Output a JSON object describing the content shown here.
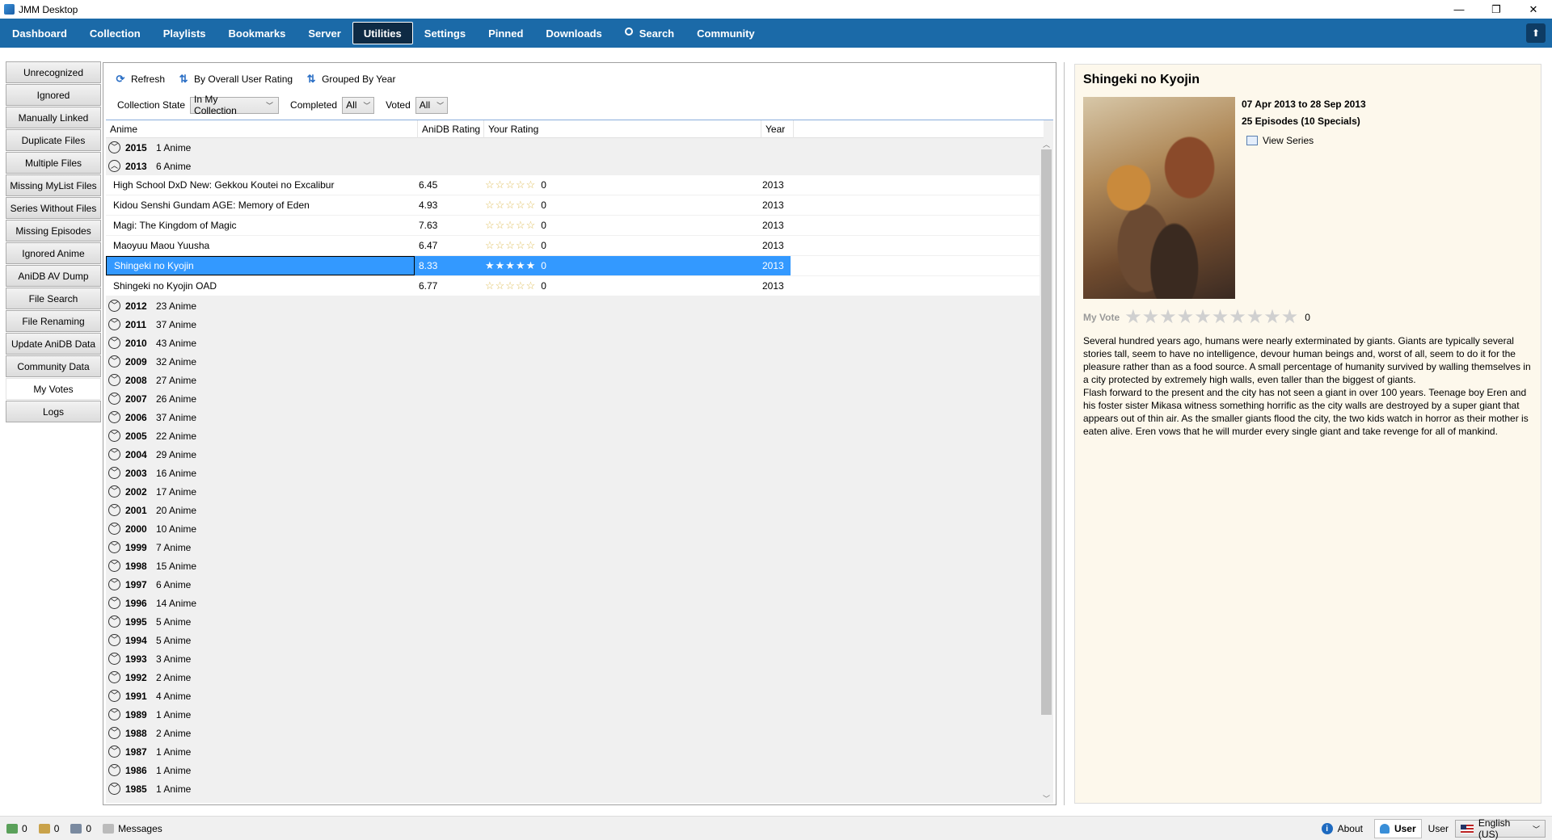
{
  "window": {
    "title": "JMM Desktop",
    "minimize": "—",
    "restore": "❐",
    "close": "✕"
  },
  "nav": {
    "items": [
      {
        "label": "Dashboard"
      },
      {
        "label": "Collection"
      },
      {
        "label": "Playlists"
      },
      {
        "label": "Bookmarks"
      },
      {
        "label": "Server"
      },
      {
        "label": "Utilities",
        "active": true
      },
      {
        "label": "Settings"
      },
      {
        "label": "Pinned"
      },
      {
        "label": "Downloads"
      },
      {
        "label": "Search",
        "icon": "search-icon"
      },
      {
        "label": "Community"
      }
    ],
    "right_icon": "upload-icon"
  },
  "sidebar": {
    "items": [
      {
        "label": "Unrecognized"
      },
      {
        "label": "Ignored"
      },
      {
        "label": "Manually Linked"
      },
      {
        "label": "Duplicate Files"
      },
      {
        "label": "Multiple Files"
      },
      {
        "label": "Missing MyList Files"
      },
      {
        "label": "Series Without Files"
      },
      {
        "label": "Missing Episodes"
      },
      {
        "label": "Ignored Anime"
      },
      {
        "label": "AniDB AV Dump"
      },
      {
        "label": "File Search"
      },
      {
        "label": "File Renaming"
      },
      {
        "label": "Update AniDB Data"
      },
      {
        "label": "Community Data"
      },
      {
        "label": "My Votes",
        "selected": true
      },
      {
        "label": "Logs"
      }
    ]
  },
  "toolbar": {
    "refresh": "Refresh",
    "by_rating": "By Overall User Rating",
    "grouped": "Grouped By Year",
    "collection_state_label": "Collection State",
    "collection_state_value": "In My Collection",
    "completed_label": "Completed",
    "completed_value": "All",
    "voted_label": "Voted",
    "voted_value": "All"
  },
  "grid": {
    "headers": [
      "Anime",
      "AniDB Rating",
      "Your Rating",
      "Year"
    ],
    "groups_top": [
      {
        "year": "2015",
        "count": "1 Anime",
        "expanded": false
      },
      {
        "year": "2013",
        "count": "6 Anime",
        "expanded": true
      }
    ],
    "rows_2013": [
      {
        "name": "High School DxD New: Gekkou Koutei no Excalibur",
        "rating": "6.45",
        "stars": "☆☆☆☆☆",
        "vote": "0",
        "year": "2013"
      },
      {
        "name": "Kidou Senshi Gundam AGE: Memory of Eden",
        "rating": "4.93",
        "stars": "☆☆☆☆☆",
        "vote": "0",
        "year": "2013"
      },
      {
        "name": "Magi: The Kingdom of Magic",
        "rating": "7.63",
        "stars": "☆☆☆☆☆",
        "vote": "0",
        "year": "2013"
      },
      {
        "name": "Maoyuu Maou Yuusha",
        "rating": "6.47",
        "stars": "☆☆☆☆☆",
        "vote": "0",
        "year": "2013"
      },
      {
        "name": "Shingeki no Kyojin",
        "rating": "8.33",
        "stars": "★★★★★",
        "vote": "0",
        "year": "2013",
        "selected": true
      },
      {
        "name": "Shingeki no Kyojin OAD",
        "rating": "6.77",
        "stars": "☆☆☆☆☆",
        "vote": "0",
        "year": "2013"
      }
    ],
    "groups_rest": [
      {
        "year": "2012",
        "count": "23 Anime"
      },
      {
        "year": "2011",
        "count": "37 Anime"
      },
      {
        "year": "2010",
        "count": "43 Anime"
      },
      {
        "year": "2009",
        "count": "32 Anime"
      },
      {
        "year": "2008",
        "count": "27 Anime"
      },
      {
        "year": "2007",
        "count": "26 Anime"
      },
      {
        "year": "2006",
        "count": "37 Anime"
      },
      {
        "year": "2005",
        "count": "22 Anime"
      },
      {
        "year": "2004",
        "count": "29 Anime"
      },
      {
        "year": "2003",
        "count": "16 Anime"
      },
      {
        "year": "2002",
        "count": "17 Anime"
      },
      {
        "year": "2001",
        "count": "20 Anime"
      },
      {
        "year": "2000",
        "count": "10 Anime"
      },
      {
        "year": "1999",
        "count": "7 Anime"
      },
      {
        "year": "1998",
        "count": "15 Anime"
      },
      {
        "year": "1997",
        "count": "6 Anime"
      },
      {
        "year": "1996",
        "count": "14 Anime"
      },
      {
        "year": "1995",
        "count": "5 Anime"
      },
      {
        "year": "1994",
        "count": "5 Anime"
      },
      {
        "year": "1993",
        "count": "3 Anime"
      },
      {
        "year": "1992",
        "count": "2 Anime"
      },
      {
        "year": "1991",
        "count": "4 Anime"
      },
      {
        "year": "1989",
        "count": "1 Anime"
      },
      {
        "year": "1988",
        "count": "2 Anime"
      },
      {
        "year": "1987",
        "count": "1 Anime"
      },
      {
        "year": "1986",
        "count": "1 Anime"
      },
      {
        "year": "1985",
        "count": "1 Anime"
      }
    ]
  },
  "detail": {
    "title": "Shingeki no Kyojin",
    "dates": "07 Apr 2013  to  28 Sep 2013",
    "episodes": "25 Episodes (10 Specials)",
    "view_series": "View Series",
    "my_vote_label": "My Vote",
    "my_vote_stars": "★★★★★★★★★★",
    "my_vote_value": "0",
    "description_1": "Several hundred years ago, humans were nearly exterminated by giants. Giants are typically several stories tall, seem to have no intelligence, devour human beings and, worst of all, seem to do it for the pleasure rather than as a food source. A small percentage of humanity survived by walling themselves in a city protected by extremely high walls, even taller than the biggest of giants.",
    "description_2": "Flash forward to the present and the city has not seen a giant in over 100 years. Teenage boy  Eren and his foster sister  Mikasa witness something horrific as the city walls are destroyed by a super giant that appears out of thin air. As the smaller giants flood the city, the two kids watch in horror as their mother is eaten alive. Eren vows that he will murder every single giant and take revenge for all of mankind."
  },
  "status": {
    "queue1": "0",
    "queue2": "0",
    "queue3": "0",
    "messages": "Messages",
    "about": "About",
    "user_button": "User",
    "user_text": "User",
    "language": "English (US)"
  },
  "colors": {
    "nav_bg": "#1b6aa8",
    "selection": "#3399ff",
    "detail_bg": "#fdf8ec"
  }
}
